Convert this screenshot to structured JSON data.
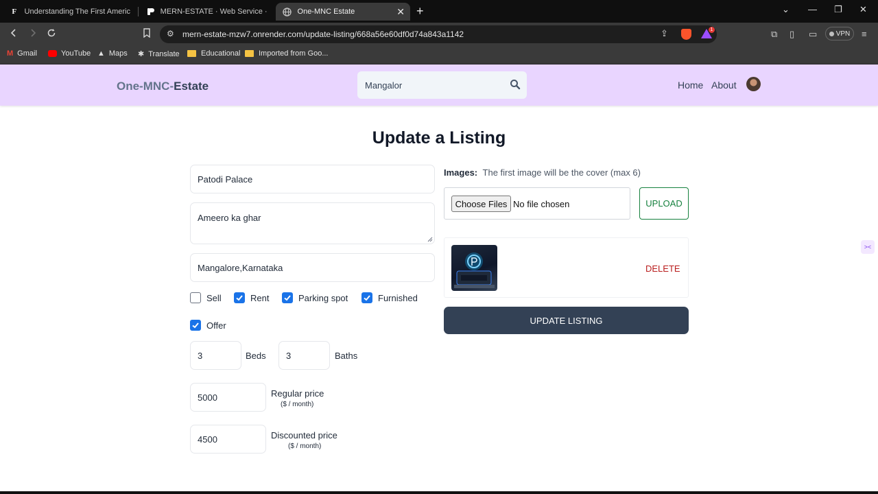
{
  "browser": {
    "tabs": [
      {
        "title": "Understanding The First American Fi",
        "favicon": "F"
      },
      {
        "title": "MERN-ESTATE · Web Service · Rend",
        "favicon": "render-icon"
      },
      {
        "title": "One-MNC Estate",
        "favicon": "globe-icon",
        "active": true
      }
    ],
    "url": "mern-estate-mzw7.onrender.com/update-listing/668a56e60df0d74a843a1142",
    "vpn_label": "VPN",
    "shields_badge": "1",
    "bookmarks": [
      "Gmail",
      "YouTube",
      "Maps",
      "Translate",
      "Educational",
      "Imported from Goo..."
    ]
  },
  "header": {
    "logo_part1": "One-MNC-",
    "logo_part2": "Estate",
    "search_value": "Mangalor",
    "nav": {
      "home": "Home",
      "about": "About"
    }
  },
  "form": {
    "title": "Update a Listing",
    "name": "Patodi Palace",
    "description": "Ameero ka ghar",
    "address": "Mangalore,Karnataka",
    "checkboxes": {
      "sell": {
        "label": "Sell",
        "checked": false
      },
      "rent": {
        "label": "Rent",
        "checked": true
      },
      "parking": {
        "label": "Parking spot",
        "checked": true
      },
      "furnished": {
        "label": "Furnished",
        "checked": true
      },
      "offer": {
        "label": "Offer",
        "checked": true
      }
    },
    "beds": {
      "value": "3",
      "label": "Beds"
    },
    "baths": {
      "value": "3",
      "label": "Baths"
    },
    "regular_price": {
      "value": "5000",
      "label": "Regular price",
      "unit": "($ / month)"
    },
    "discounted_price": {
      "value": "4500",
      "label": "Discounted price",
      "unit": "($ / month)"
    }
  },
  "images": {
    "label": "Images:",
    "hint": "The first image will be the cover (max 6)",
    "choose_files": "Choose Files",
    "no_file": "No file chosen",
    "upload": "UPLOAD",
    "delete": "DELETE"
  },
  "submit": "UPDATE LISTING",
  "colors": {
    "header_bg": "#e9d5ff",
    "checkbox": "#1a73e8",
    "button": "#334155",
    "upload": "#15803d",
    "delete": "#b91c1c"
  }
}
